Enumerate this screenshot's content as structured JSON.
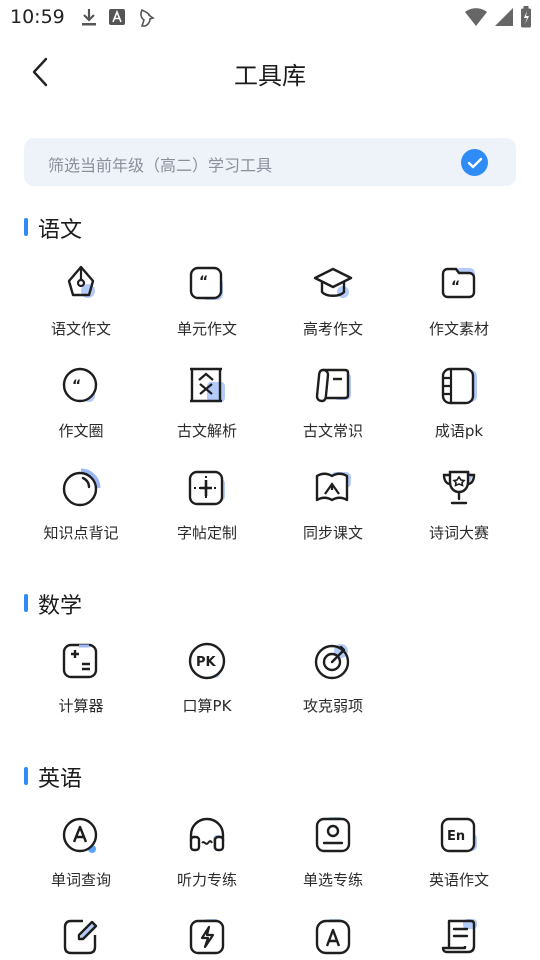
{
  "status_bar": {
    "time": "10:59",
    "left_icons": [
      "download-icon",
      "font-icon",
      "bird-icon"
    ],
    "right_icons": [
      "wifi-icon",
      "signal-icon",
      "battery-icon"
    ]
  },
  "header": {
    "title": "工具库",
    "back_icon": "chevron-left-icon"
  },
  "filter": {
    "label": "筛选当前年级（高二）学习工具",
    "checked": true
  },
  "colors": {
    "accent": "#2f8cf6",
    "filter_bg": "#eef3fa",
    "icon_shadow": "#9bb8f6"
  },
  "sections": [
    {
      "title": "语文",
      "tools": [
        {
          "label": "语文作文",
          "icon": "pen-nib-icon"
        },
        {
          "label": "单元作文",
          "icon": "quote-box-icon"
        },
        {
          "label": "高考作文",
          "icon": "graduation-cap-icon"
        },
        {
          "label": "作文素材",
          "icon": "folder-quote-icon"
        },
        {
          "label": "作文圈",
          "icon": "chat-quote-icon"
        },
        {
          "label": "古文解析",
          "icon": "ancient-text-icon"
        },
        {
          "label": "古文常识",
          "icon": "book-scroll-icon"
        },
        {
          "label": "成语pk",
          "icon": "film-book-icon"
        },
        {
          "label": "知识点背记",
          "icon": "circle-progress-icon"
        },
        {
          "label": "字帖定制",
          "icon": "grid-character-icon"
        },
        {
          "label": "同步课文",
          "icon": "open-book-icon"
        },
        {
          "label": "诗词大赛",
          "icon": "trophy-icon"
        }
      ]
    },
    {
      "title": "数学",
      "tools": [
        {
          "label": "计算器",
          "icon": "calculator-icon"
        },
        {
          "label": "口算PK",
          "icon": "pk-badge-icon"
        },
        {
          "label": "攻克弱项",
          "icon": "target-icon"
        }
      ]
    },
    {
      "title": "英语",
      "tools": [
        {
          "label": "单词查询",
          "icon": "letter-a-circle-icon"
        },
        {
          "label": "听力专练",
          "icon": "headphones-icon"
        },
        {
          "label": "单选专练",
          "icon": "person-card-icon"
        },
        {
          "label": "英语作文",
          "icon": "en-box-icon"
        },
        {
          "label": "",
          "icon": "edit-note-icon"
        },
        {
          "label": "",
          "icon": "lightning-box-icon"
        },
        {
          "label": "",
          "icon": "letter-a-box-icon"
        },
        {
          "label": "",
          "icon": "scroll-list-icon"
        }
      ]
    }
  ]
}
